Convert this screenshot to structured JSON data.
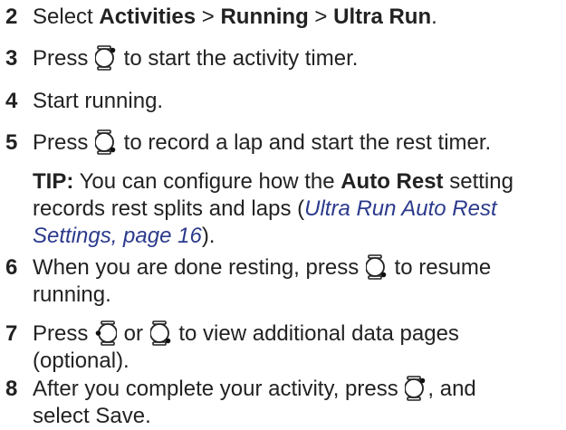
{
  "colors": {
    "text": "#222222",
    "link": "#2b3a8c"
  },
  "steps": [
    {
      "num": "2",
      "t1": "Select ",
      "b1": "Activities",
      "t2": " > ",
      "b2": "Running",
      "t3": " > ",
      "b3": "Ultra Run",
      "t4": "."
    },
    {
      "num": "3",
      "t1": "Press ",
      "icon": "watch-button-upper-right-icon",
      "t2": " to start the activity timer."
    },
    {
      "num": "4",
      "t1": "Start running."
    },
    {
      "num": "5",
      "t1": "Press ",
      "icon": "watch-button-lower-right-icon",
      "t2": " to record a lap and start the rest timer."
    },
    {
      "tip_label": "TIP:",
      "tip_t1": " You can configure how the ",
      "tip_b": "Auto Rest",
      "tip_t2": " setting",
      "tip_t3": "records rest splits and laps (",
      "tip_link1": "Ultra Run Auto Rest",
      "tip_link2": "Settings, page 16",
      "tip_t4": ")."
    },
    {
      "num": "6",
      "t1": "When you are done resting, press ",
      "icon": "watch-button-lower-right-icon",
      "t2": " to resume",
      "t3": "running."
    },
    {
      "num": "7",
      "t1": "Press ",
      "icon1": "watch-button-left-icon",
      "t2": " or ",
      "icon2": "watch-button-lower-right-icon",
      "t3": " to view additional data pages",
      "t4": "(optional)."
    },
    {
      "num": "8",
      "t1": "After you complete your activity, press ",
      "icon": "watch-button-upper-right-icon",
      "t2": ", and",
      "t3": "select Save."
    }
  ]
}
